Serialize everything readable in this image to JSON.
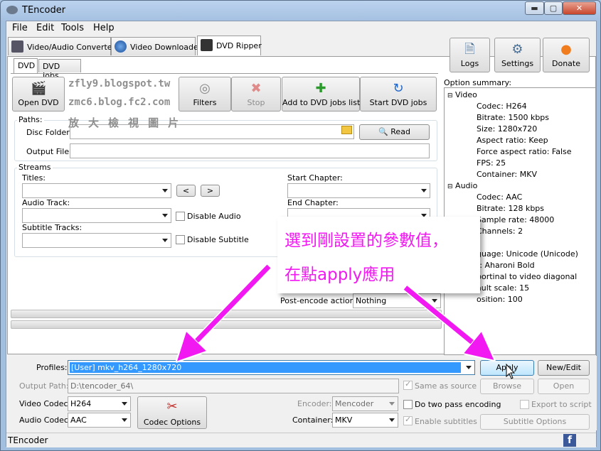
{
  "window": {
    "title": "TEncoder",
    "controls": [
      "minimize-icon",
      "maximize-icon",
      "close-icon"
    ]
  },
  "menu": [
    "File",
    "Edit",
    "Tools",
    "Help"
  ],
  "tabs": [
    {
      "label": "Video/Audio Converter",
      "icon": "film-icon"
    },
    {
      "label": "Video Downloader",
      "icon": "globe-icon"
    },
    {
      "label": "DVD Ripper",
      "icon": "clapper-icon",
      "selected": true
    }
  ],
  "subtabs": [
    "DVD",
    "DVD Jobs"
  ],
  "toolbar": {
    "open_dvd": "Open DVD",
    "filters": "Filters",
    "stop": "Stop",
    "add_jobs": "Add to DVD jobs list",
    "start_jobs": "Start DVD jobs"
  },
  "right_buttons": {
    "logs": "Logs",
    "settings": "Settings",
    "donate": "Donate"
  },
  "watermark": {
    "line1": "zfly9.blogspot.tw",
    "line2": "zmc6.blog.fc2.com",
    "line3": "放 大 檢 視 圖 片"
  },
  "paths": {
    "group": "Paths:",
    "disc_folder": "Disc Folder:",
    "output_file": "Output File:",
    "read": "Read"
  },
  "streams": {
    "group": "Streams",
    "titles": "Titles:",
    "audio_track": "Audio Track:",
    "subtitle_tracks": "Subtitle Tracks:",
    "disable_audio": "Disable Audio",
    "disable_subtitle": "Disable Subtitle",
    "start_chapter": "Start Chapter:",
    "end_chapter": "End Chapter:",
    "prev": "<",
    "next": ">"
  },
  "post_encode": {
    "label": "Post-encode action:",
    "value": "Nothing"
  },
  "option_summary": {
    "title": "Option summary:",
    "video_header": "Video",
    "video": [
      "Codec: H264",
      "Bitrate: 1500 kbps",
      "Size: 1280x720",
      "Aspect ratio: Keep",
      "Force aspect ratio: False",
      "FPS: 25",
      "Container: MKV"
    ],
    "audio_header": "Audio",
    "audio": [
      "Codec: AAC",
      "Bitrate: 128 kbps",
      "Sample rate: 48000",
      "Channels: 2"
    ],
    "subtitle_partial": [
      "guage: Unicode (Unicode)",
      "t: Aharoni Bold",
      "portinal to video diagonal",
      "ault scale: 15",
      "osition: 100"
    ]
  },
  "profiles": {
    "label": "Profiles:",
    "value": "[User] mkv_h264_1280x720",
    "apply": "Apply",
    "new_edit": "New/Edit"
  },
  "output_path": {
    "label": "Output Path:",
    "value": "D:\\tencoder_64\\",
    "same_as_source": "Same as source",
    "browse": "Browse",
    "open": "Open"
  },
  "encoding": {
    "video_codec_label": "Video Codec:",
    "video_codec": "H264",
    "audio_codec_label": "Audio Codec:",
    "audio_codec": "AAC",
    "codec_options": "Codec Options",
    "encoder_label": "Encoder:",
    "encoder": "Mencoder",
    "container_label": "Container:",
    "container": "MKV",
    "two_pass": "Do two pass encoding",
    "enable_subtitles": "Enable subtitles",
    "export_script": "Export to script",
    "subtitle_options": "Subtitle Options"
  },
  "status": {
    "text": "TEncoder"
  },
  "annotation": {
    "line1": "選到剛設置的參數值，",
    "line2": "在點apply應用"
  },
  "colors": {
    "accent_arrow": "#f218f2",
    "profile_highlight": "#3399ff",
    "donate": "#f07c1e"
  }
}
